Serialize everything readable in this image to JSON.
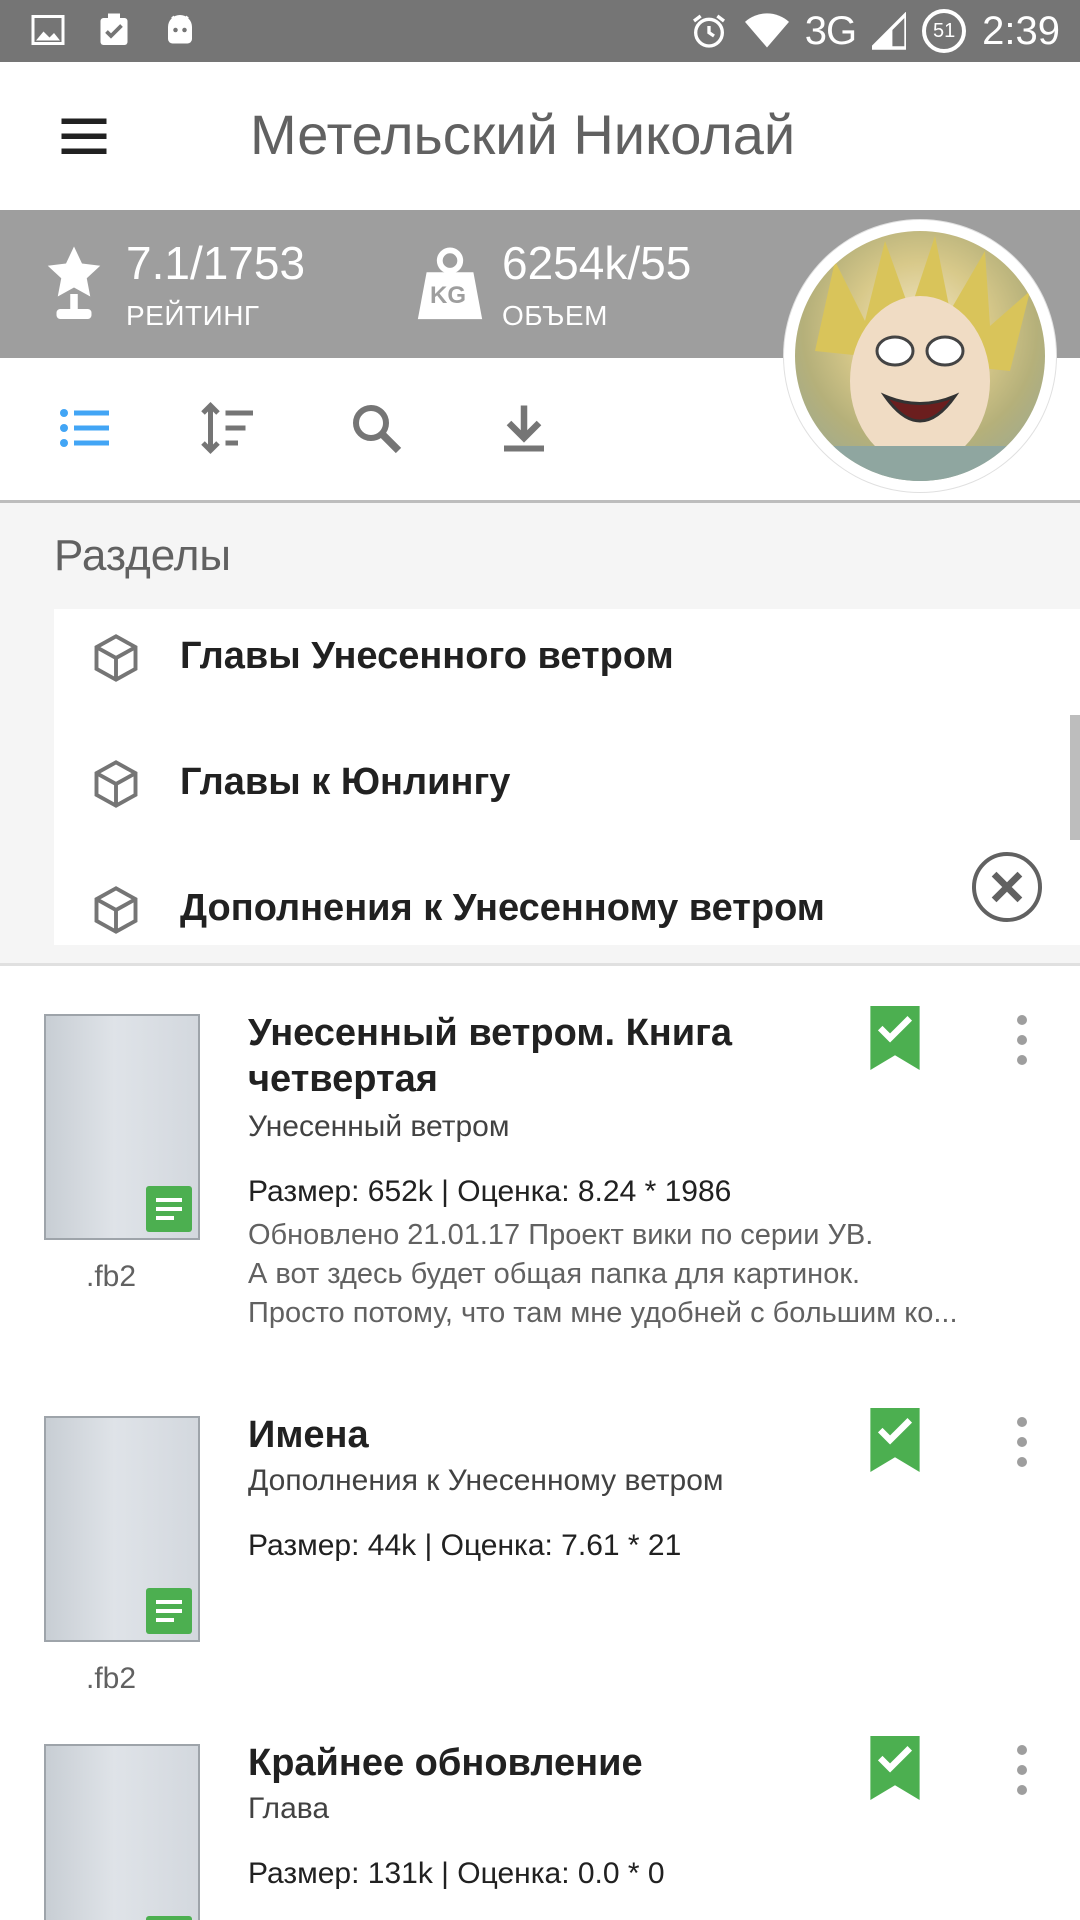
{
  "status_bar": {
    "network": "3G",
    "battery": "51",
    "time": "2:39"
  },
  "app_bar": {
    "title": "Метельский Николай"
  },
  "stats": {
    "rating_value": "7.1/1753",
    "rating_label": "РЕЙТИНГ",
    "volume_value": "6254k/55",
    "volume_label": "ОБЪЕМ",
    "kg_badge": "KG"
  },
  "colors": {
    "accent": "#42a5f5",
    "bookmark": "#4caf50",
    "stats_bg": "#9e9e9e"
  },
  "sections": {
    "title": "Разделы",
    "items": [
      {
        "label": "Главы Унесенного ветром"
      },
      {
        "label": "Главы к Юнлингу"
      },
      {
        "label": "Дополнения к Унесенному ветром"
      }
    ]
  },
  "books": [
    {
      "title": "Унесенный ветром. Книга четвертая",
      "section": "Унесенный ветром",
      "meta": "Размер: 652k  |  Оценка: 8.24 * 1986",
      "desc": [
        "Обновлено 21.01.17 Проект вики по серии УВ.",
        "А вот здесь будет общая папка для картинок.",
        "Просто потому, что там мне удобней с большим ко..."
      ],
      "ext": ".fb2"
    },
    {
      "title": "Имена",
      "section": "Дополнения к Унесенному ветром",
      "meta": "Размер: 44k  |  Оценка: 7.61 * 21",
      "ext": ".fb2"
    },
    {
      "title": "Крайнее обновление",
      "section": "Глава",
      "meta": "Размер: 131k  |  Оценка: 0.0 * 0"
    }
  ]
}
